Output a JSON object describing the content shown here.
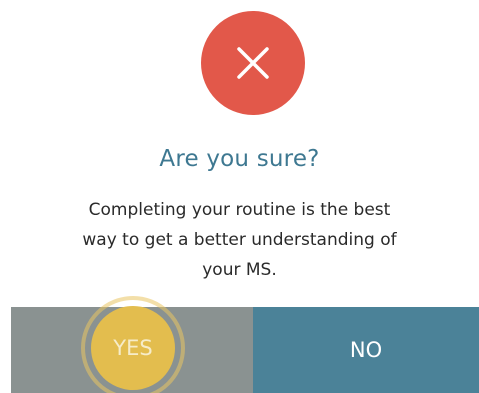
{
  "icons": {
    "status": "close-icon"
  },
  "colors": {
    "alert_red": "#e2584a",
    "title_blue": "#3e7891",
    "yes_gray": "#8a9291",
    "no_teal": "#4b8298",
    "touch_highlight": "#e3bd4e"
  },
  "dialog": {
    "title": "Are you sure?",
    "message_lines": [
      "Completing your routine is the best",
      "way to get a better understanding of",
      "your MS."
    ],
    "buttons": {
      "yes_label": "YES",
      "no_label": "NO"
    }
  }
}
